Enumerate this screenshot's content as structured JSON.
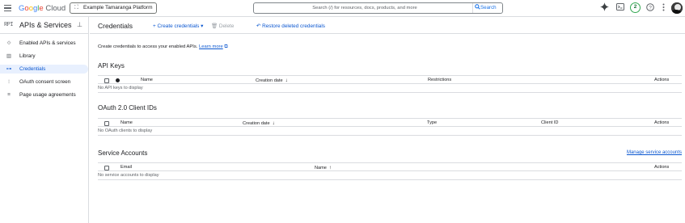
{
  "topbar": {
    "logo_google": [
      "G",
      "o",
      "o",
      "g",
      "l",
      "e"
    ],
    "logo_cloud": "Cloud",
    "project": "Example Tamaranga Platform",
    "search_placeholder": "Search (/) for resources, docs, products, and more",
    "search_button": "Search",
    "notification_count": "2"
  },
  "sidebar": {
    "glyph": "RPI",
    "title": "APIs & Services",
    "items": [
      {
        "label": "Enabled APIs & services",
        "icon": "enabled-apis-icon"
      },
      {
        "label": "Library",
        "icon": "library-icon"
      },
      {
        "label": "Credentials",
        "icon": "key-icon",
        "active": true
      },
      {
        "label": "OAuth consent screen",
        "icon": "oauth-icon"
      },
      {
        "label": "Page usage agreements",
        "icon": "agreements-icon"
      }
    ]
  },
  "toolbar": {
    "title": "Credentials",
    "create": "+ Create credentials ▾",
    "delete": "Delete",
    "restore": "Restore deleted credentials"
  },
  "intro": {
    "text": "Create credentials to access your enabled APIs.",
    "link": "Learn more"
  },
  "api_keys": {
    "title": "API Keys",
    "columns": [
      "Name",
      "Creation date",
      "Restrictions",
      "Actions"
    ],
    "empty": "No API keys to display"
  },
  "oauth": {
    "title": "OAuth 2.0 Client IDs",
    "columns": [
      "Name",
      "Creation date",
      "Type",
      "Client ID",
      "Actions"
    ],
    "empty": "No OAuth clients to display"
  },
  "service_accounts": {
    "title": "Service Accounts",
    "manage_link": "Manage service accounts",
    "columns": [
      "Email",
      "Name",
      "Actions"
    ],
    "empty": "No service accounts to display"
  },
  "colors": {
    "accent": "#0b57d0",
    "active_bg": "#e8f0fe",
    "border": "#dadce0"
  }
}
